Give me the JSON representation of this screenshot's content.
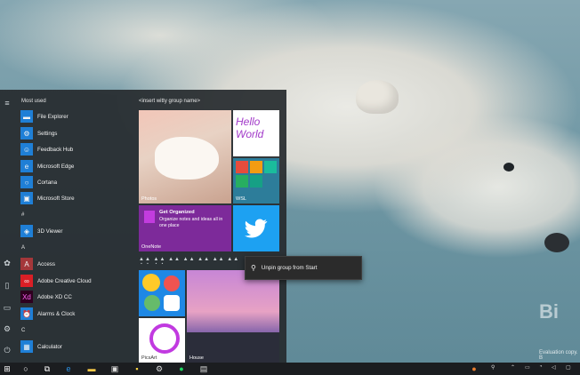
{
  "start": {
    "most_used_label": "Most used",
    "group_title": "<insert witty group name>",
    "most_used": [
      {
        "label": "File Explorer",
        "icon": "folder-icon",
        "color": "#1f7fd6"
      },
      {
        "label": "Settings",
        "icon": "gear-icon",
        "color": "#1f7fd6"
      },
      {
        "label": "Feedback Hub",
        "icon": "feedback-icon",
        "color": "#1f7fd6"
      },
      {
        "label": "Microsoft Edge",
        "icon": "edge-icon",
        "color": "#1f7fd6"
      },
      {
        "label": "Cortana",
        "icon": "cortana-icon",
        "color": "#1f7fd6"
      },
      {
        "label": "Microsoft Store",
        "icon": "store-icon",
        "color": "#1f7fd6"
      }
    ],
    "section_hash": "#",
    "hash_apps": [
      {
        "label": "3D Viewer",
        "icon": "cube-icon",
        "color": "#1f7fd6"
      }
    ],
    "section_a": "A",
    "a_apps": [
      {
        "label": "Access",
        "icon": "access-icon",
        "color": "#a4373a"
      },
      {
        "label": "Adobe Creative Cloud",
        "icon": "creative-cloud-icon",
        "color": "#da1f26"
      },
      {
        "label": "Adobe XD CC",
        "icon": "xd-icon",
        "color": "#2e001f"
      },
      {
        "label": "Alarms & Clock",
        "icon": "alarm-icon",
        "color": "#1f7fd6"
      }
    ],
    "section_c": "C",
    "c_apps": [
      {
        "label": "Calculator",
        "icon": "calculator-icon",
        "color": "#1f7fd6"
      }
    ],
    "tiles": {
      "photos_label": "Photos",
      "onenote_title": "Get Organized",
      "onenote_text": "Organize notes and ideas all in one place",
      "onenote_label": "OneNote",
      "wsl_label": "WSL",
      "picsart_label": "PicsArt",
      "house_label": "House",
      "hello_world": "Hello World"
    },
    "context_menu": {
      "unpin_group": "Unpin group from Start"
    }
  },
  "desktop": {
    "bing_text": "Bi",
    "eval_text": "Evaluation copy. B"
  },
  "colors": {
    "accent": "#1f7fd6",
    "onenote": "#7d2a9a",
    "twitter": "#1da1f2"
  }
}
